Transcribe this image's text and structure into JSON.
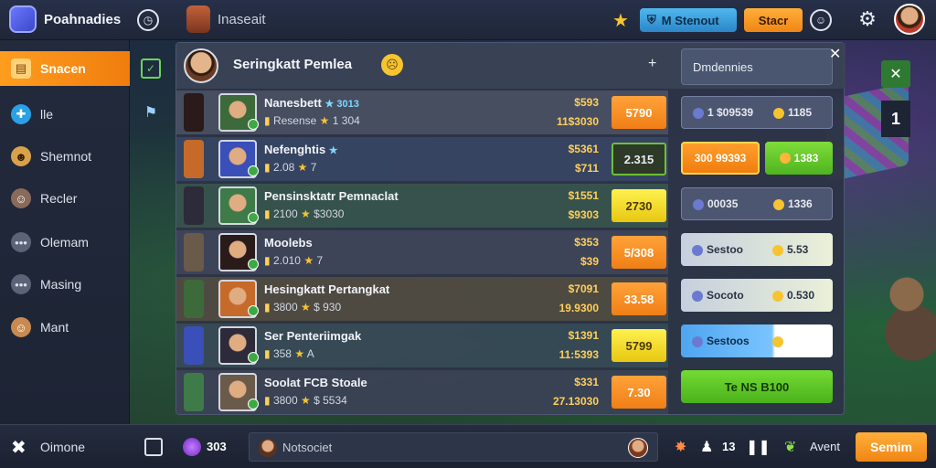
{
  "app": {
    "title": "Poahnadies",
    "subtitle": "Inaseait"
  },
  "topbar": {
    "pill_blue": "M Stenout",
    "pill_orange": "Stacr"
  },
  "sidebar": {
    "items": [
      {
        "label": "Snacen",
        "icon": "home-icon",
        "active": true
      },
      {
        "label": "lle",
        "icon": "puzzle-icon"
      },
      {
        "label": "Shemnot",
        "icon": "hero-icon"
      },
      {
        "label": "Recler",
        "icon": "character-icon"
      },
      {
        "label": "Olemam",
        "icon": "chat-icon"
      },
      {
        "label": "Masing",
        "icon": "chat-icon"
      },
      {
        "label": "Mant",
        "icon": "user-icon"
      }
    ]
  },
  "panel": {
    "title": "Seringkatt Pemlea",
    "plus": "+",
    "right_header": "Dmdennies"
  },
  "rows": [
    {
      "name": "Nanesbett",
      "name_tag": "★ 3013",
      "sub": "Resense",
      "sub_val": "1 304",
      "v1": "$593",
      "v2": "11$3030",
      "btn": "5790",
      "btn_style": "orange"
    },
    {
      "name": "Nefenghtis",
      "name_tag": "★",
      "sub": "2.08",
      "sub_val": "7",
      "v1": "$5361",
      "v2": "$711",
      "btn": "2.315",
      "btn_style": "dark"
    },
    {
      "name": "Pensinsktatr Pemnaclat",
      "name_tag": "",
      "sub": "2100",
      "sub_val": "$3030",
      "v1": "$1551",
      "v2": "$9303",
      "btn": "2730",
      "btn_style": "yellow"
    },
    {
      "name": "Moolebs",
      "name_tag": "",
      "sub": "2.010",
      "sub_val": "7",
      "v1": "$353",
      "v2": "$39",
      "btn": "5/308",
      "btn_style": "orange"
    },
    {
      "name": "Hesingkatt Pertangkat",
      "name_tag": "",
      "sub": "3800",
      "sub_val": "$ 930",
      "v1": "$7091",
      "v2": "19.9300",
      "btn": "33.58",
      "btn_style": "orange"
    },
    {
      "name": "Ser Penteriimgak",
      "name_tag": "",
      "sub": "358",
      "sub_val": "A",
      "v1": "$1391",
      "v2": "11:5393",
      "btn": "5799",
      "btn_style": "yellow"
    },
    {
      "name": "Soolat FCB Stoale",
      "name_tag": "",
      "sub": "3800",
      "sub_val": "$ 5534",
      "v1": "$331",
      "v2": "27.13030",
      "btn": "7.30",
      "btn_style": "orange"
    }
  ],
  "side_cards": [
    {
      "a": "1  $09539",
      "b": "1185",
      "style": "grey"
    },
    {
      "a": "300 99393",
      "b": "1383",
      "style": "split"
    },
    {
      "a": "00035",
      "b": "1336",
      "style": "grey"
    },
    {
      "a": "Sestoo",
      "b": "5.53",
      "style": "light"
    },
    {
      "a": "Socoto",
      "b": "0.530",
      "style": "light"
    },
    {
      "a": "Sestoos",
      "b": "",
      "style": "blue"
    },
    {
      "a": "Te NS B100",
      "b": "",
      "style": "green"
    }
  ],
  "right_float": {
    "top_icon": "x-icon",
    "number": "1"
  },
  "bottombar": {
    "label": "Oimone",
    "gems": "303",
    "chat_placeholder": "Notsociet",
    "count": "13",
    "next_label": "Avent",
    "button": "Semim"
  },
  "colors": {
    "accent": "#f58a14",
    "gold": "#ffcf5a",
    "green": "#5cc22a"
  }
}
